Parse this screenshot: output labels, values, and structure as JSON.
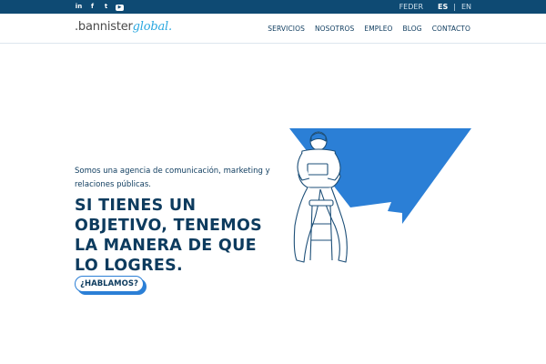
{
  "topbar": {
    "social": [
      {
        "icon": "linkedin-icon",
        "glyph": "in"
      },
      {
        "icon": "facebook-icon",
        "glyph": "f"
      },
      {
        "icon": "twitter-icon",
        "glyph": "t"
      },
      {
        "icon": "youtube-icon",
        "glyph": "▶"
      }
    ],
    "feder": "FEDER",
    "lang_es": "ES",
    "lang_sep": "|",
    "lang_en": "EN"
  },
  "header": {
    "logo_prefix": ".bannister",
    "logo_suffix": "global.",
    "nav": [
      "SERVICIOS",
      "NOSOTROS",
      "EMPLEO",
      "BLOG",
      "CONTACTO"
    ]
  },
  "hero": {
    "intro": "Somos una agencia de comunicación, marketing y relaciones públicas.",
    "headline": "SI TIENES UN OBJETIVO, TENEMOS LA MANERA DE QUE LO LOGRES.",
    "cta": "¿HABLAMOS?"
  },
  "colors": {
    "topbar": "#0e4a73",
    "brand_blue": "#2b7fd6",
    "text": "#0d3b5e"
  }
}
